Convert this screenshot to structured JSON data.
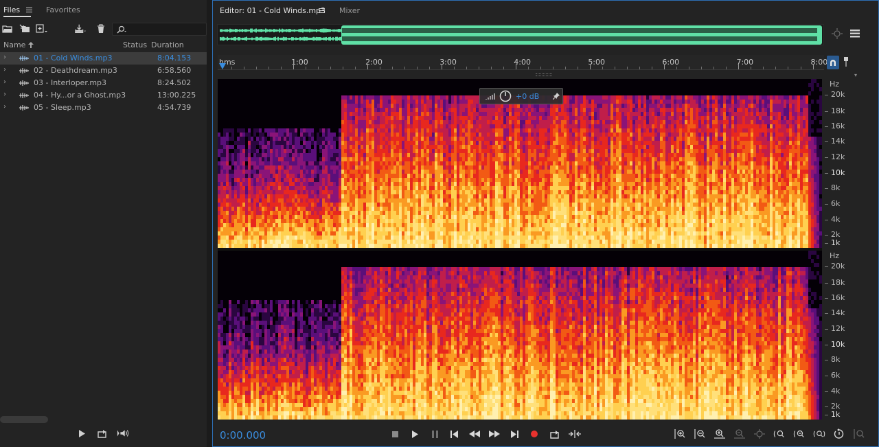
{
  "files_panel": {
    "tabs": [
      {
        "label": "Files",
        "active": true
      },
      {
        "label": "Favorites",
        "active": false
      }
    ],
    "search": {
      "placeholder": "",
      "value": ""
    },
    "columns": {
      "name": "Name",
      "status": "Status",
      "duration": "Duration"
    },
    "files": [
      {
        "name": "01 - Cold Winds.mp3",
        "status": "",
        "duration": "8:04.153",
        "selected": true
      },
      {
        "name": "02 - Deathdream.mp3",
        "status": "",
        "duration": "6:58.560",
        "selected": false
      },
      {
        "name": "03 - Interloper.mp3",
        "status": "",
        "duration": "8:24.502",
        "selected": false
      },
      {
        "name": "04 - Hy...or a Ghost.mp3",
        "status": "",
        "duration": "13:00.225",
        "selected": false
      },
      {
        "name": "05 - Sleep.mp3",
        "status": "",
        "duration": "4:54.739",
        "selected": false
      }
    ],
    "toolbar_icons": [
      "open-folder-icon",
      "import-icon",
      "new-file-icon",
      "export-icon",
      "trash-icon",
      "search-icon"
    ],
    "transport_icons": [
      "play-icon",
      "loop-icon",
      "autoplay-icon"
    ]
  },
  "editor": {
    "tabs": [
      {
        "label": "Editor: 01 - Cold Winds.mp3",
        "active": true
      },
      {
        "label": "Mixer",
        "active": false
      }
    ],
    "ruler": {
      "unit_label": "hms",
      "ticks": [
        "1:00",
        "2:00",
        "3:00",
        "4:00",
        "5:00",
        "6:00",
        "7:00",
        "8:00"
      ]
    },
    "hud": {
      "gain": "+0 dB"
    },
    "hz_scale": {
      "unit": "Hz",
      "labels": [
        {
          "text": "20k",
          "bold": false
        },
        {
          "text": "18k",
          "bold": false
        },
        {
          "text": "16k",
          "bold": false
        },
        {
          "text": "14k",
          "bold": false
        },
        {
          "text": "12k",
          "bold": false
        },
        {
          "text": "10k",
          "bold": true
        },
        {
          "text": "8k",
          "bold": false
        },
        {
          "text": "6k",
          "bold": false
        },
        {
          "text": "4k",
          "bold": false
        },
        {
          "text": "2k",
          "bold": false
        },
        {
          "text": "1k",
          "bold": true
        }
      ]
    },
    "current_time": "0:00.000",
    "duration_seconds": 484.153,
    "selection_start_seconds": 0,
    "transport_icons": [
      "stop-icon",
      "play-icon",
      "pause-icon",
      "go-to-start-icon",
      "rewind-icon",
      "fast-forward-icon",
      "go-to-end-icon",
      "record-icon",
      "loop-icon",
      "skip-selection-icon"
    ],
    "zoom_icons": [
      "zoom-in-amplitude-icon",
      "zoom-out-amplitude-icon",
      "zoom-in-time-icon",
      "zoom-out-time-icon",
      "zoom-out-full-icon",
      "zoom-in-selection-icon",
      "zoom-in-left-icon",
      "zoom-in-right-icon",
      "zoom-reset-icon",
      "zoom-fit-icon"
    ]
  },
  "colors": {
    "accent": "#3a8dde",
    "overview_waveform": "#5fe0a6",
    "record": "#e8322e",
    "spectral_low": "#ffe07a",
    "spectral_mid": "#e8281e",
    "spectral_high": "#5a0f7a"
  }
}
